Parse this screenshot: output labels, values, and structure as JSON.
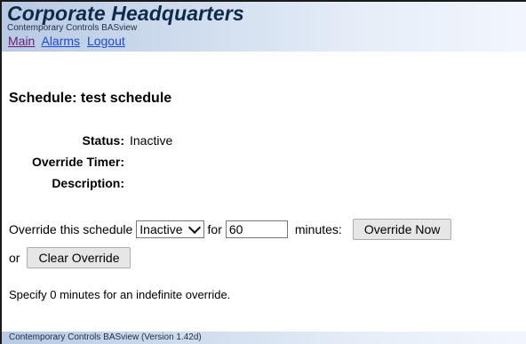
{
  "header": {
    "title": "Corporate Headquarters",
    "subtitle": "Contemporary Controls BASview",
    "nav": [
      {
        "label": "Main"
      },
      {
        "label": "Alarms"
      },
      {
        "label": "Logout"
      }
    ]
  },
  "schedule": {
    "heading": "Schedule: test schedule",
    "status_label": "Status:",
    "status_value": "Inactive",
    "override_timer_label": "Override Timer:",
    "override_timer_value": "",
    "description_label": "Description:",
    "description_value": ""
  },
  "override": {
    "prefix_text": "Override this schedule",
    "state_selected": "Inactive",
    "for_text": "for",
    "minutes_value": "60",
    "minutes_text": "minutes:",
    "override_now_label": "Override Now",
    "or_text": "or",
    "clear_override_label": "Clear Override",
    "hint_text": "Specify 0 minutes for an indefinite override."
  },
  "footer": {
    "text": "Contemporary Controls BASview (Version 1.42d)"
  },
  "colors": {
    "header_gradient_start": "#b7c9e3",
    "title_color": "#0e2a4a",
    "visited_link": "#6a1b7a",
    "link": "#1a4bd1"
  }
}
